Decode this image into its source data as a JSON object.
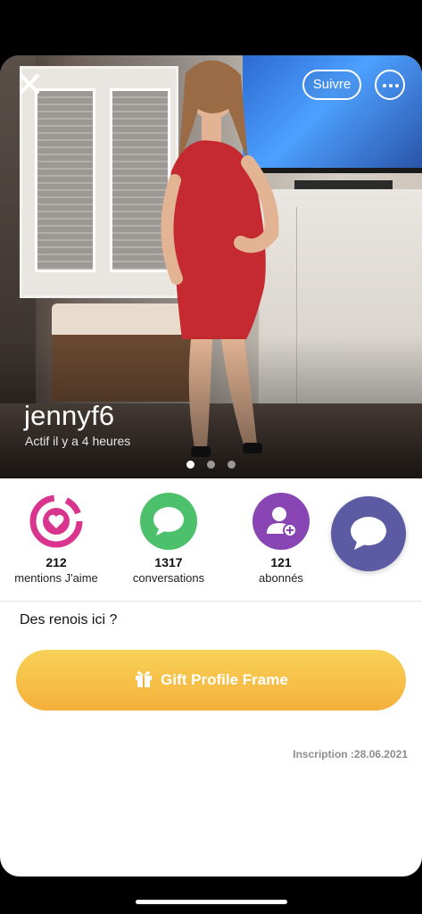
{
  "profile": {
    "username": "jennyf6",
    "activity": "Actif il y a 4 heures",
    "photo_count": 3,
    "photo_active_index": 0,
    "bio": "Des renois ici ?",
    "signup": "Inscription :28.06.2021"
  },
  "header": {
    "close_icon": "close-icon",
    "follow_label": "Suivre",
    "more_icon": "more-icon"
  },
  "stats": [
    {
      "value": "212",
      "label": "mentions J'aime",
      "icon": "heart-ring-icon",
      "color": "#d9358f"
    },
    {
      "value": "1317",
      "label": "conversations",
      "icon": "chat-bubble-icon",
      "color": "#4cc06a"
    },
    {
      "value": "121",
      "label": "abonnés",
      "icon": "add-user-icon",
      "color": "#8a45b5"
    }
  ],
  "actions": {
    "gift_label": "Gift Profile Frame",
    "gift_icon": "gift-icon",
    "chat_icon": "chat-bubble-icon",
    "chat_color": "#5c5aa3",
    "gift_color": "#f5b03b"
  }
}
